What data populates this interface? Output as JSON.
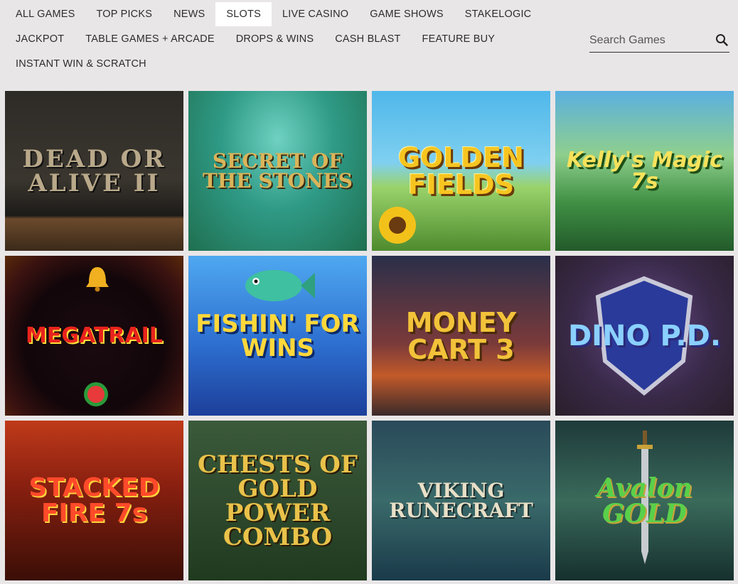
{
  "nav": {
    "tabs": [
      {
        "label": "ALL GAMES"
      },
      {
        "label": "TOP PICKS"
      },
      {
        "label": "NEWS"
      },
      {
        "label": "SLOTS",
        "active": true
      },
      {
        "label": "LIVE CASINO"
      },
      {
        "label": "GAME SHOWS"
      },
      {
        "label": "STAKELOGIC"
      },
      {
        "label": "JACKPOT"
      },
      {
        "label": "TABLE GAMES + ARCADE"
      },
      {
        "label": "DROPS & WINS"
      },
      {
        "label": "CASH BLAST"
      },
      {
        "label": "FEATURE BUY"
      },
      {
        "label": "INSTANT WIN & SCRATCH"
      }
    ]
  },
  "search": {
    "placeholder": "Search Games",
    "icon": "search-icon"
  },
  "games": [
    {
      "title": "DEAD OR ALIVE II"
    },
    {
      "title": "SECRET OF THE STONES"
    },
    {
      "title": "GOLDEN FIELDS"
    },
    {
      "title": "Kelly's Magic 7s"
    },
    {
      "title": "MEGATRAIL"
    },
    {
      "title": "FISHIN' FOR WINS"
    },
    {
      "title": "MONEY CART 3"
    },
    {
      "title": "DINO P.D."
    },
    {
      "title": "STACKED FIRE 7s"
    },
    {
      "title": "CHESTS OF GOLD POWER COMBO"
    },
    {
      "title": "VIKING RUNECRAFT"
    },
    {
      "title": "Avalon GOLD"
    }
  ]
}
